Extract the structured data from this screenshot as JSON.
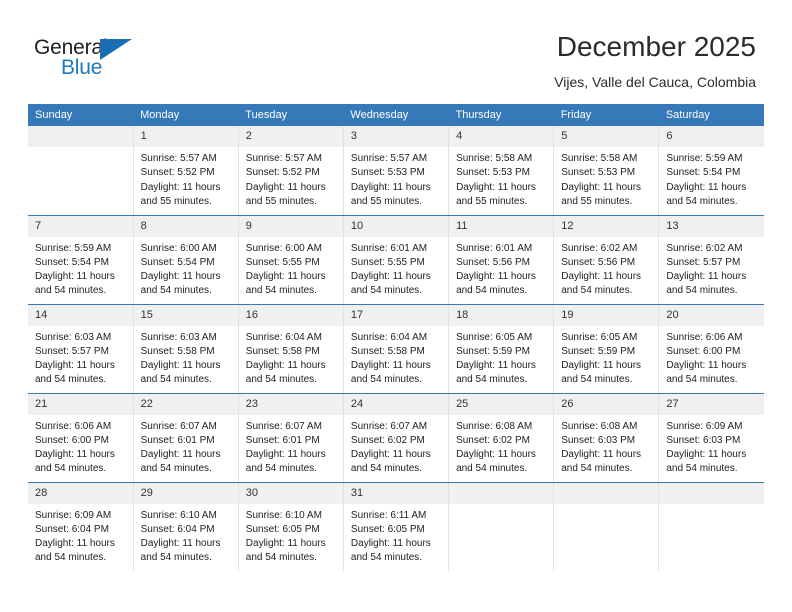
{
  "brand": {
    "name_top": "General",
    "name_bottom": "Blue",
    "triangle_color": "#1b6eb3",
    "blue_text_color": "#1f7ac0"
  },
  "header": {
    "title": "December 2025",
    "subtitle": "Vijes, Valle del Cauca, Colombia",
    "header_bg": "#3579b8",
    "header_text_color": "#ffffff"
  },
  "weekday_headers": [
    "Sunday",
    "Monday",
    "Tuesday",
    "Wednesday",
    "Thursday",
    "Friday",
    "Saturday"
  ],
  "labels": {
    "sunrise_prefix": "Sunrise:",
    "sunset_prefix": "Sunset:",
    "daylight_prefix": "Daylight:"
  },
  "weeks": [
    [
      {
        "day": "",
        "sunrise": "",
        "sunset": "",
        "daylight_line1": "",
        "daylight_line2": ""
      },
      {
        "day": "1",
        "sunrise": "Sunrise: 5:57 AM",
        "sunset": "Sunset: 5:52 PM",
        "daylight_line1": "Daylight: 11 hours",
        "daylight_line2": "and 55 minutes."
      },
      {
        "day": "2",
        "sunrise": "Sunrise: 5:57 AM",
        "sunset": "Sunset: 5:52 PM",
        "daylight_line1": "Daylight: 11 hours",
        "daylight_line2": "and 55 minutes."
      },
      {
        "day": "3",
        "sunrise": "Sunrise: 5:57 AM",
        "sunset": "Sunset: 5:53 PM",
        "daylight_line1": "Daylight: 11 hours",
        "daylight_line2": "and 55 minutes."
      },
      {
        "day": "4",
        "sunrise": "Sunrise: 5:58 AM",
        "sunset": "Sunset: 5:53 PM",
        "daylight_line1": "Daylight: 11 hours",
        "daylight_line2": "and 55 minutes."
      },
      {
        "day": "5",
        "sunrise": "Sunrise: 5:58 AM",
        "sunset": "Sunset: 5:53 PM",
        "daylight_line1": "Daylight: 11 hours",
        "daylight_line2": "and 55 minutes."
      },
      {
        "day": "6",
        "sunrise": "Sunrise: 5:59 AM",
        "sunset": "Sunset: 5:54 PM",
        "daylight_line1": "Daylight: 11 hours",
        "daylight_line2": "and 54 minutes."
      }
    ],
    [
      {
        "day": "7",
        "sunrise": "Sunrise: 5:59 AM",
        "sunset": "Sunset: 5:54 PM",
        "daylight_line1": "Daylight: 11 hours",
        "daylight_line2": "and 54 minutes."
      },
      {
        "day": "8",
        "sunrise": "Sunrise: 6:00 AM",
        "sunset": "Sunset: 5:54 PM",
        "daylight_line1": "Daylight: 11 hours",
        "daylight_line2": "and 54 minutes."
      },
      {
        "day": "9",
        "sunrise": "Sunrise: 6:00 AM",
        "sunset": "Sunset: 5:55 PM",
        "daylight_line1": "Daylight: 11 hours",
        "daylight_line2": "and 54 minutes."
      },
      {
        "day": "10",
        "sunrise": "Sunrise: 6:01 AM",
        "sunset": "Sunset: 5:55 PM",
        "daylight_line1": "Daylight: 11 hours",
        "daylight_line2": "and 54 minutes."
      },
      {
        "day": "11",
        "sunrise": "Sunrise: 6:01 AM",
        "sunset": "Sunset: 5:56 PM",
        "daylight_line1": "Daylight: 11 hours",
        "daylight_line2": "and 54 minutes."
      },
      {
        "day": "12",
        "sunrise": "Sunrise: 6:02 AM",
        "sunset": "Sunset: 5:56 PM",
        "daylight_line1": "Daylight: 11 hours",
        "daylight_line2": "and 54 minutes."
      },
      {
        "day": "13",
        "sunrise": "Sunrise: 6:02 AM",
        "sunset": "Sunset: 5:57 PM",
        "daylight_line1": "Daylight: 11 hours",
        "daylight_line2": "and 54 minutes."
      }
    ],
    [
      {
        "day": "14",
        "sunrise": "Sunrise: 6:03 AM",
        "sunset": "Sunset: 5:57 PM",
        "daylight_line1": "Daylight: 11 hours",
        "daylight_line2": "and 54 minutes."
      },
      {
        "day": "15",
        "sunrise": "Sunrise: 6:03 AM",
        "sunset": "Sunset: 5:58 PM",
        "daylight_line1": "Daylight: 11 hours",
        "daylight_line2": "and 54 minutes."
      },
      {
        "day": "16",
        "sunrise": "Sunrise: 6:04 AM",
        "sunset": "Sunset: 5:58 PM",
        "daylight_line1": "Daylight: 11 hours",
        "daylight_line2": "and 54 minutes."
      },
      {
        "day": "17",
        "sunrise": "Sunrise: 6:04 AM",
        "sunset": "Sunset: 5:58 PM",
        "daylight_line1": "Daylight: 11 hours",
        "daylight_line2": "and 54 minutes."
      },
      {
        "day": "18",
        "sunrise": "Sunrise: 6:05 AM",
        "sunset": "Sunset: 5:59 PM",
        "daylight_line1": "Daylight: 11 hours",
        "daylight_line2": "and 54 minutes."
      },
      {
        "day": "19",
        "sunrise": "Sunrise: 6:05 AM",
        "sunset": "Sunset: 5:59 PM",
        "daylight_line1": "Daylight: 11 hours",
        "daylight_line2": "and 54 minutes."
      },
      {
        "day": "20",
        "sunrise": "Sunrise: 6:06 AM",
        "sunset": "Sunset: 6:00 PM",
        "daylight_line1": "Daylight: 11 hours",
        "daylight_line2": "and 54 minutes."
      }
    ],
    [
      {
        "day": "21",
        "sunrise": "Sunrise: 6:06 AM",
        "sunset": "Sunset: 6:00 PM",
        "daylight_line1": "Daylight: 11 hours",
        "daylight_line2": "and 54 minutes."
      },
      {
        "day": "22",
        "sunrise": "Sunrise: 6:07 AM",
        "sunset": "Sunset: 6:01 PM",
        "daylight_line1": "Daylight: 11 hours",
        "daylight_line2": "and 54 minutes."
      },
      {
        "day": "23",
        "sunrise": "Sunrise: 6:07 AM",
        "sunset": "Sunset: 6:01 PM",
        "daylight_line1": "Daylight: 11 hours",
        "daylight_line2": "and 54 minutes."
      },
      {
        "day": "24",
        "sunrise": "Sunrise: 6:07 AM",
        "sunset": "Sunset: 6:02 PM",
        "daylight_line1": "Daylight: 11 hours",
        "daylight_line2": "and 54 minutes."
      },
      {
        "day": "25",
        "sunrise": "Sunrise: 6:08 AM",
        "sunset": "Sunset: 6:02 PM",
        "daylight_line1": "Daylight: 11 hours",
        "daylight_line2": "and 54 minutes."
      },
      {
        "day": "26",
        "sunrise": "Sunrise: 6:08 AM",
        "sunset": "Sunset: 6:03 PM",
        "daylight_line1": "Daylight: 11 hours",
        "daylight_line2": "and 54 minutes."
      },
      {
        "day": "27",
        "sunrise": "Sunrise: 6:09 AM",
        "sunset": "Sunset: 6:03 PM",
        "daylight_line1": "Daylight: 11 hours",
        "daylight_line2": "and 54 minutes."
      }
    ],
    [
      {
        "day": "28",
        "sunrise": "Sunrise: 6:09 AM",
        "sunset": "Sunset: 6:04 PM",
        "daylight_line1": "Daylight: 11 hours",
        "daylight_line2": "and 54 minutes."
      },
      {
        "day": "29",
        "sunrise": "Sunrise: 6:10 AM",
        "sunset": "Sunset: 6:04 PM",
        "daylight_line1": "Daylight: 11 hours",
        "daylight_line2": "and 54 minutes."
      },
      {
        "day": "30",
        "sunrise": "Sunrise: 6:10 AM",
        "sunset": "Sunset: 6:05 PM",
        "daylight_line1": "Daylight: 11 hours",
        "daylight_line2": "and 54 minutes."
      },
      {
        "day": "31",
        "sunrise": "Sunrise: 6:11 AM",
        "sunset": "Sunset: 6:05 PM",
        "daylight_line1": "Daylight: 11 hours",
        "daylight_line2": "and 54 minutes."
      },
      {
        "day": "",
        "sunrise": "",
        "sunset": "",
        "daylight_line1": "",
        "daylight_line2": ""
      },
      {
        "day": "",
        "sunrise": "",
        "sunset": "",
        "daylight_line1": "",
        "daylight_line2": ""
      },
      {
        "day": "",
        "sunrise": "",
        "sunset": "",
        "daylight_line1": "",
        "daylight_line2": ""
      }
    ]
  ]
}
